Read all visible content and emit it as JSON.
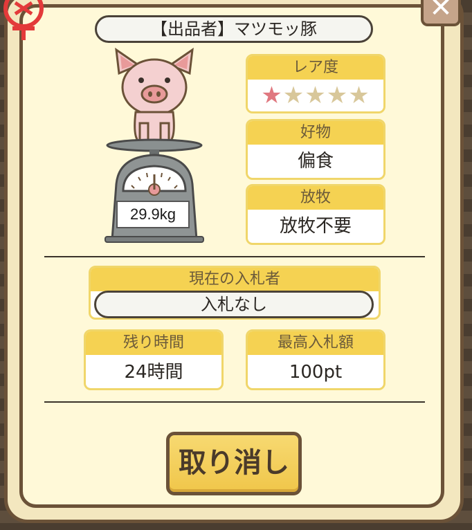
{
  "seller": {
    "label": "【出品者】マツモッ豚"
  },
  "weight": "29.9kg",
  "rarity": {
    "label": "レア度",
    "rating": 1,
    "max": 5,
    "stars_on": "★",
    "stars_off": "★★★★"
  },
  "favorite": {
    "label": "好物",
    "value": "偏食"
  },
  "grazing": {
    "label": "放牧",
    "value": "放牧不要"
  },
  "bidder": {
    "label": "現在の入札者",
    "value": "入札なし"
  },
  "remaining": {
    "label": "残り時間",
    "value": "24時間"
  },
  "max_bid": {
    "label": "最高入札額",
    "value": "100pt"
  },
  "cancel_button": "取り消し",
  "close_icon": "close-icon",
  "colors": {
    "accent": "#f5d252",
    "border": "#6b5238",
    "star_on": "#e07880",
    "star_off": "#d8c79a"
  }
}
